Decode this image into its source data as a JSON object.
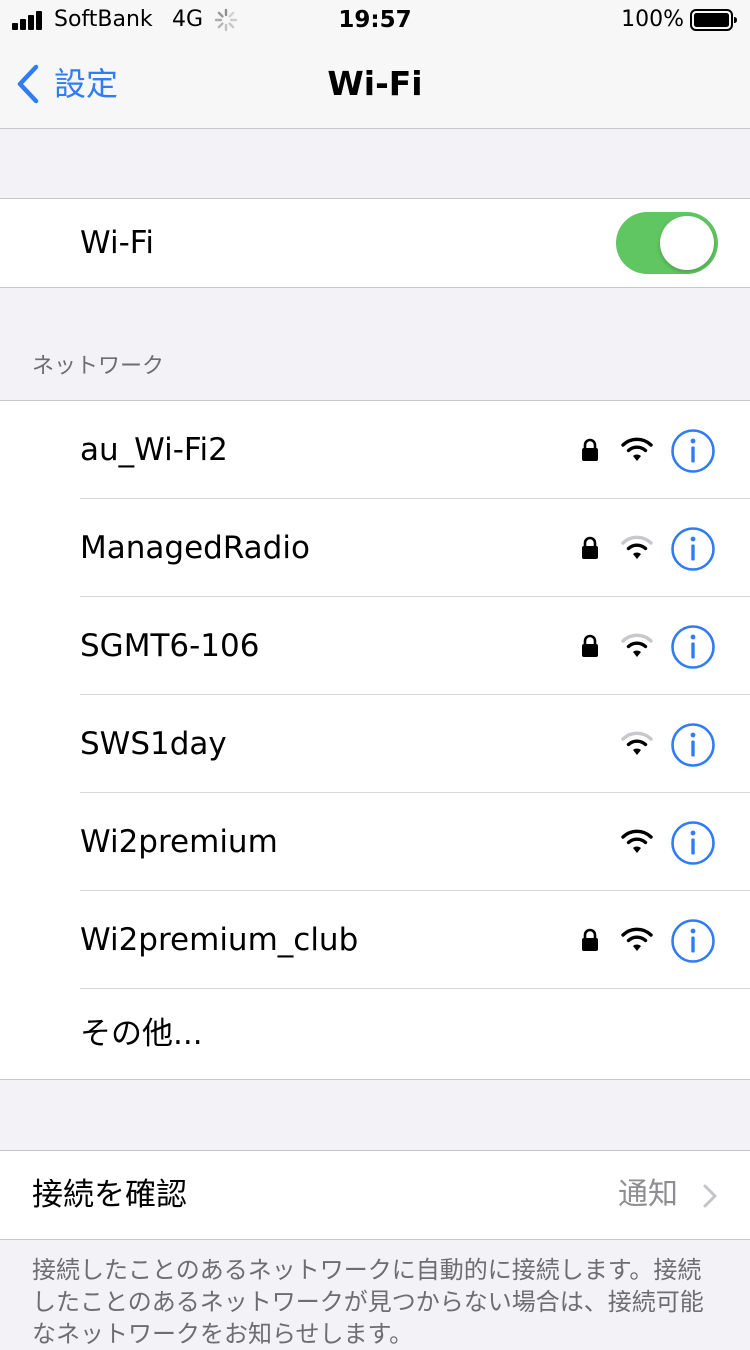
{
  "status_bar": {
    "carrier": "SoftBank",
    "network_type": "4G",
    "time": "19:57",
    "battery_percent": "100%",
    "signal_icon": "cellular-signal-icon",
    "battery_icon": "battery-full-icon"
  },
  "nav": {
    "back_label": "設定",
    "title": "Wi-Fi"
  },
  "wifi_toggle": {
    "label": "Wi-Fi",
    "on": true,
    "color": "#5fc661"
  },
  "networks_section": {
    "header": "ネットワーク",
    "networks": [
      {
        "name": "au_Wi-Fi2",
        "locked": true,
        "signal": 3
      },
      {
        "name": "ManagedRadio",
        "locked": true,
        "signal": 2
      },
      {
        "name": "SGMT6-106",
        "locked": true,
        "signal": 2
      },
      {
        "name": "SWS1day",
        "locked": false,
        "signal": 2
      },
      {
        "name": "Wi2premium",
        "locked": false,
        "signal": 3
      },
      {
        "name": "Wi2premium_club",
        "locked": true,
        "signal": 3
      }
    ],
    "other_label": "その他..."
  },
  "ask_to_join": {
    "label": "接続を確認",
    "value": "通知"
  },
  "footer_note": "接続したことのあるネットワークに自動的に接続します。接続したことのあるネットワークが見つからない場合は、接続可能なネットワークをお知らせします。",
  "colors": {
    "accent": "#2f7cf6",
    "toggle_on": "#5fc661",
    "background": "#f2f2f7"
  }
}
